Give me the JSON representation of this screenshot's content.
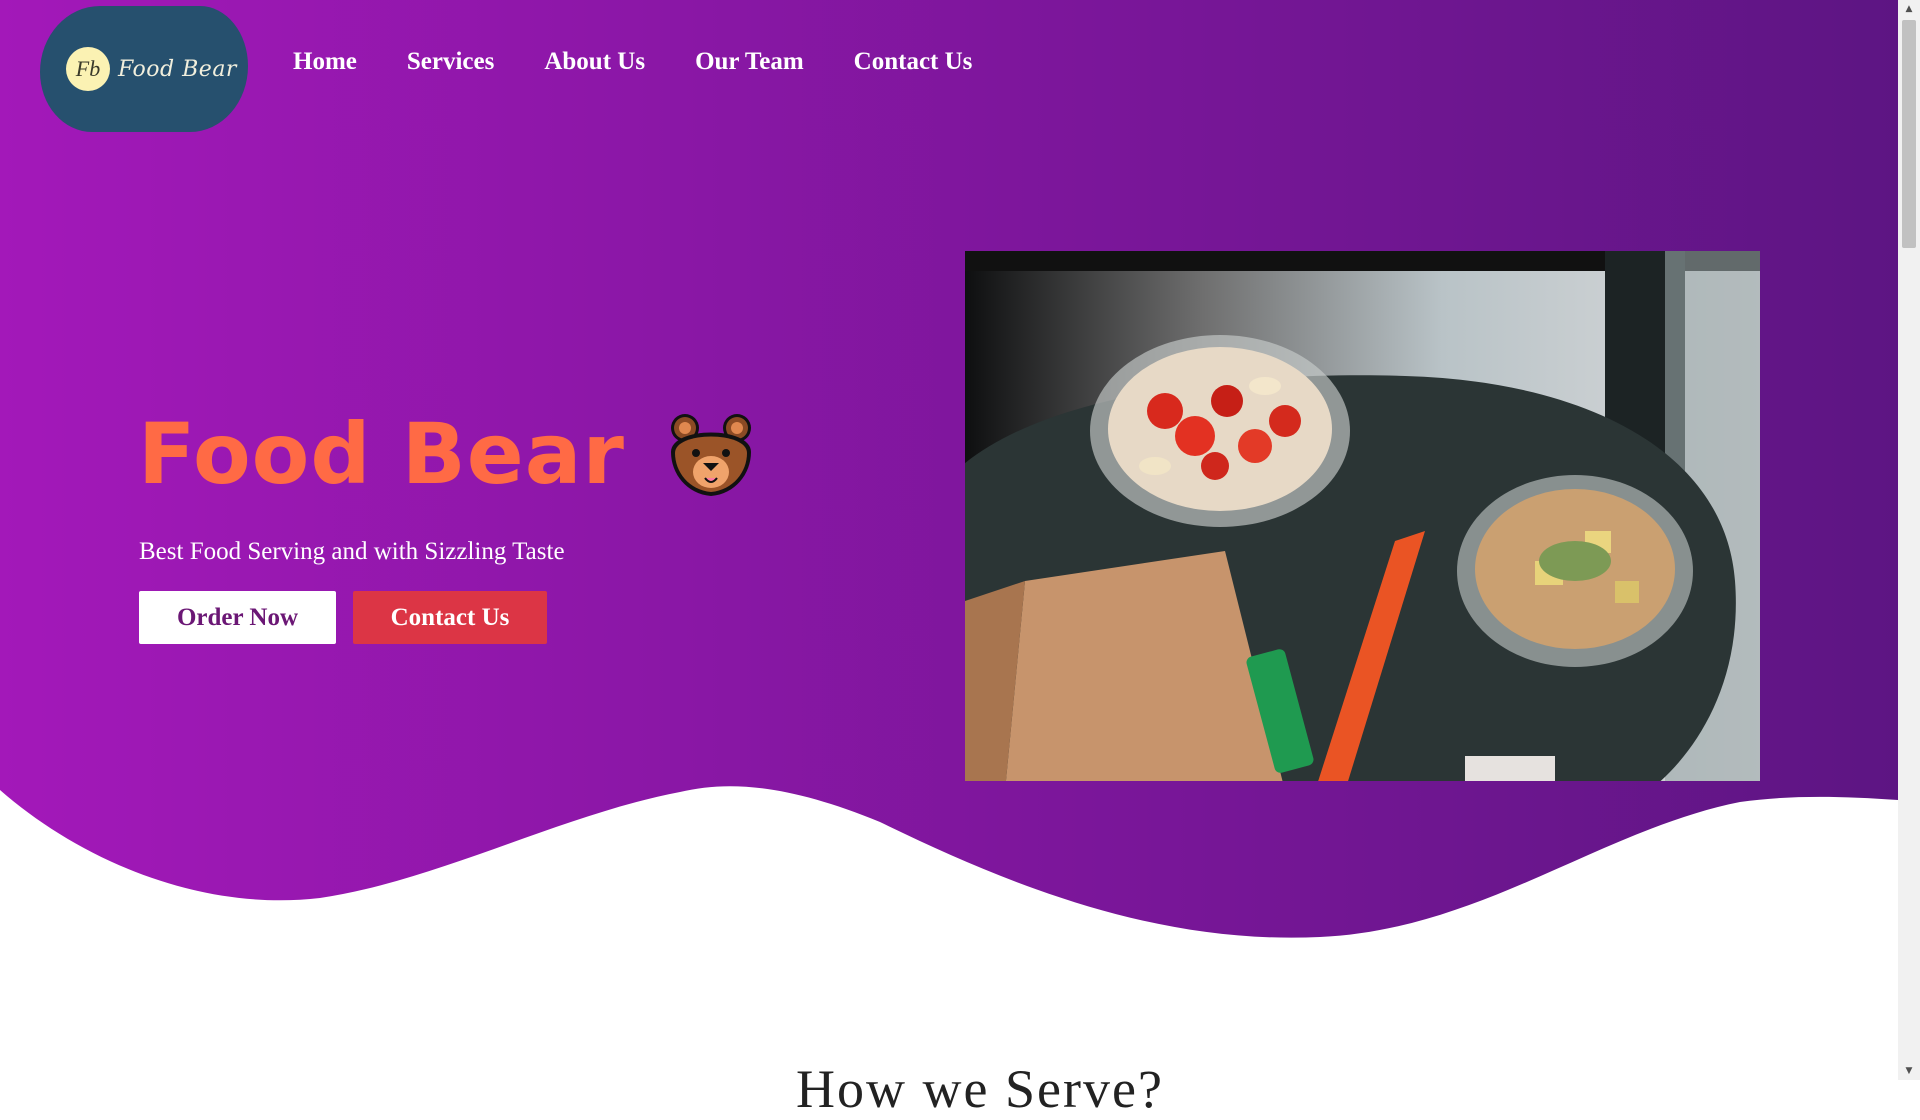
{
  "brand": {
    "logo_initials": "Fb",
    "logo_text": "Food Bear",
    "logo_bg": "#26506e",
    "logo_mark_bg": "#fbf2b3"
  },
  "nav": {
    "items": [
      {
        "label": "Home"
      },
      {
        "label": "Services"
      },
      {
        "label": "About Us"
      },
      {
        "label": "Our Team"
      },
      {
        "label": "Contact Us"
      }
    ]
  },
  "hero": {
    "title": "Food Bear",
    "emoji_icon": "bear-face-icon",
    "tagline": "Best Food Serving and with Sizzling Taste",
    "order_button": "Order Now",
    "contact_button": "Contact Us",
    "gradient_start": "#a318b9",
    "gradient_end": "#5d1583",
    "title_color": "#ff6a45",
    "contact_button_color": "#dc3545",
    "photo_icon": "food-bowls-photo"
  },
  "next_section": {
    "heading": "How we Serve?"
  }
}
